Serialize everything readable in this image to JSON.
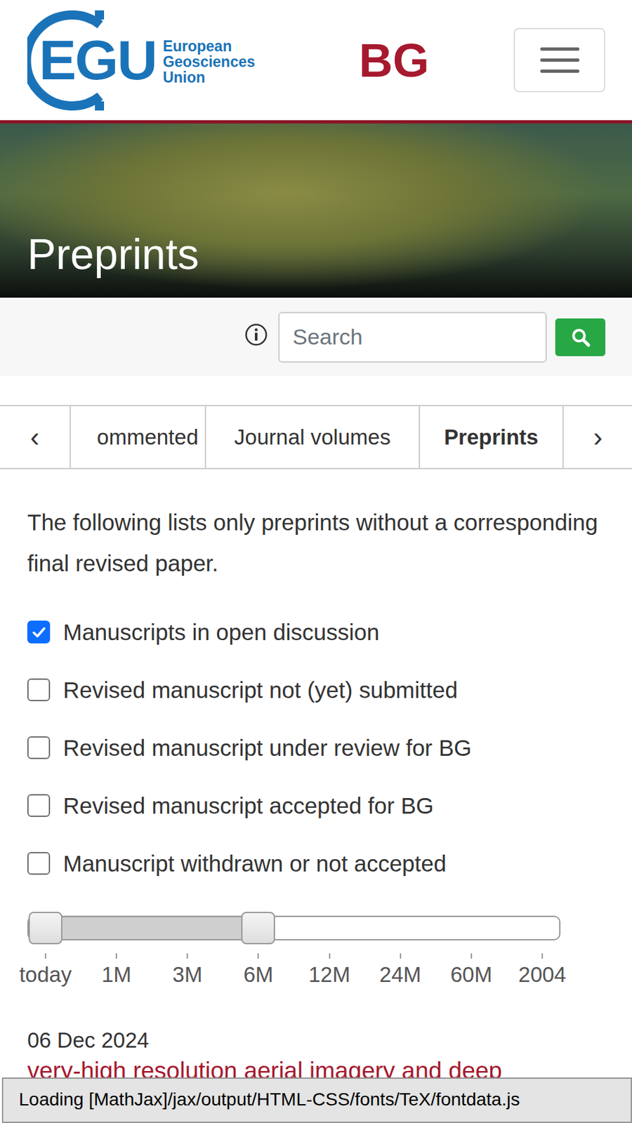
{
  "header": {
    "logo_letters": "EGU",
    "logo_lines": [
      "European",
      "Geosciences",
      "Union"
    ],
    "journal": "BG"
  },
  "banner": {
    "title": "Preprints"
  },
  "search": {
    "placeholder": "Search"
  },
  "tab_nav": {
    "prev": "‹",
    "next": "›"
  },
  "tabs": [
    {
      "label": "ommented",
      "selected": false
    },
    {
      "label": "Journal volumes",
      "selected": false
    },
    {
      "label": "Preprints",
      "selected": true
    }
  ],
  "intro": "The following lists only preprints without a corresponding final revised paper.",
  "filters": [
    {
      "label": "Manuscripts in open discussion",
      "checked": true
    },
    {
      "label": "Revised manuscript not (yet) submitted",
      "checked": false
    },
    {
      "label": "Revised manuscript under review for BG",
      "checked": false
    },
    {
      "label": "Revised manuscript accepted for BG",
      "checked": false
    },
    {
      "label": "Manuscript withdrawn or not accepted",
      "checked": false
    }
  ],
  "range_slider": {
    "labels": [
      "today",
      "1M",
      "3M",
      "6M",
      "12M",
      "24M",
      "60M",
      "2004"
    ],
    "start_level": 0,
    "end_level": 0.4286
  },
  "articles": [
    {
      "date": "06 Dec 2024",
      "title": "very-high resolution aerial imagery and deep"
    }
  ],
  "status_bar": "Loading [MathJax]/jax/output/HTML-CSS/fonts/TeX/fontdata.js"
}
